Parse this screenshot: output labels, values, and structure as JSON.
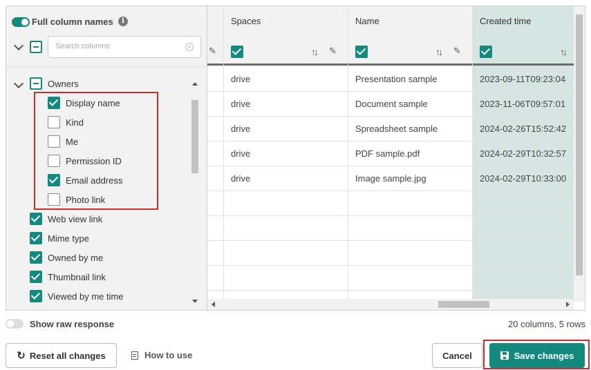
{
  "panel": {
    "full_names_label": "Full column names",
    "full_names_on": true,
    "search_placeholder": "Search columns",
    "search_value": "",
    "tree": {
      "group_label": "Owners",
      "children": [
        {
          "label": "Display name",
          "checked": true
        },
        {
          "label": "Kind",
          "checked": false
        },
        {
          "label": "Me",
          "checked": false
        },
        {
          "label": "Permission ID",
          "checked": false
        },
        {
          "label": "Email address",
          "checked": true
        },
        {
          "label": "Photo link",
          "checked": false
        }
      ],
      "items": [
        {
          "label": "Web view link",
          "checked": true
        },
        {
          "label": "Mime type",
          "checked": true
        },
        {
          "label": "Owned by me",
          "checked": true
        },
        {
          "label": "Thumbnail link",
          "checked": true
        },
        {
          "label": "Viewed by me time",
          "checked": true
        }
      ]
    }
  },
  "grid": {
    "columns": [
      {
        "title": "Spaces",
        "checked": true
      },
      {
        "title": "Name",
        "checked": true
      },
      {
        "title": "Created time",
        "checked": true
      }
    ],
    "rows": [
      [
        "drive",
        "Presentation sample",
        "2023-09-11T09:23:04"
      ],
      [
        "drive",
        "Document sample",
        "2023-11-06T09:57:01"
      ],
      [
        "drive",
        "Spreadsheet sample",
        "2024-02-26T15:52:42"
      ],
      [
        "drive",
        "PDF sample.pdf",
        "2024-02-29T10:32:57"
      ],
      [
        "drive",
        "Image sample.jpg",
        "2024-02-29T10:33:00"
      ]
    ]
  },
  "footer": {
    "raw_response_label": "Show raw response",
    "raw_response_on": false,
    "summary": "20 columns, 5 rows",
    "reset_label": "Reset all changes",
    "how_to_label": "How to use",
    "cancel_label": "Cancel",
    "save_label": "Save changes"
  },
  "colors": {
    "accent": "#14897e",
    "highlight": "#d42a2a",
    "accent_column_bg": "#d5e6e2"
  }
}
